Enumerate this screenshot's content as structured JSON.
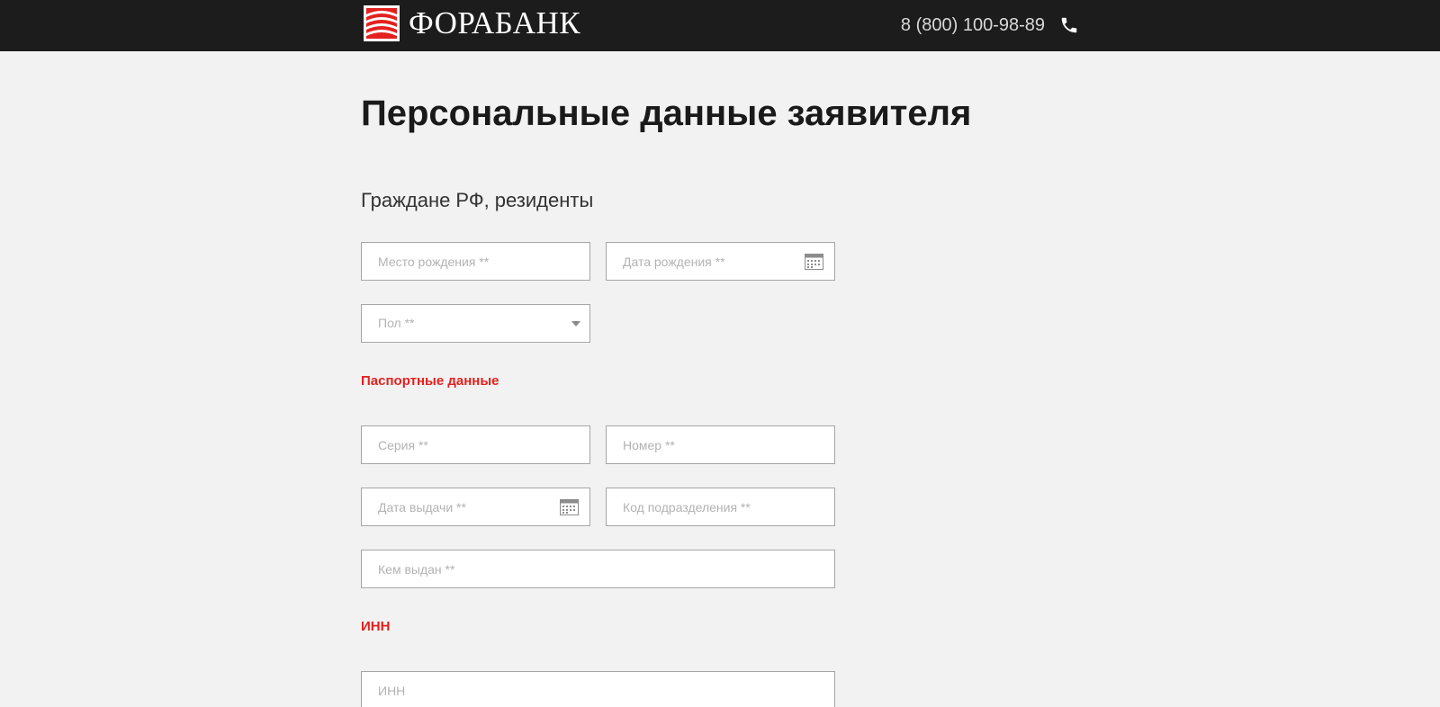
{
  "header": {
    "brand": "ФОРАБАНК",
    "phone": "8 (800) 100-98-89",
    "brand_color": "#e3211f"
  },
  "page": {
    "title": "Персональные данные заявителя",
    "subtitle": "Граждане РФ, резиденты"
  },
  "fields": {
    "birth_place": {
      "placeholder": "Место рождения **"
    },
    "birth_date": {
      "placeholder": "Дата рождения **"
    },
    "gender": {
      "placeholder": "Пол **"
    },
    "passport_series": {
      "placeholder": "Серия **"
    },
    "passport_number": {
      "placeholder": "Номер **"
    },
    "issue_date": {
      "placeholder": "Дата выдачи **"
    },
    "division_code": {
      "placeholder": "Код подразделения **"
    },
    "issued_by": {
      "placeholder": "Кем выдан **"
    },
    "inn": {
      "placeholder": "ИНН"
    }
  },
  "sections": {
    "passport": "Паспортные данные",
    "inn": "ИНН"
  },
  "icons": {
    "phone": "phone-icon",
    "calendar": "calendar-icon",
    "dropdown": "chevron-down-icon"
  }
}
